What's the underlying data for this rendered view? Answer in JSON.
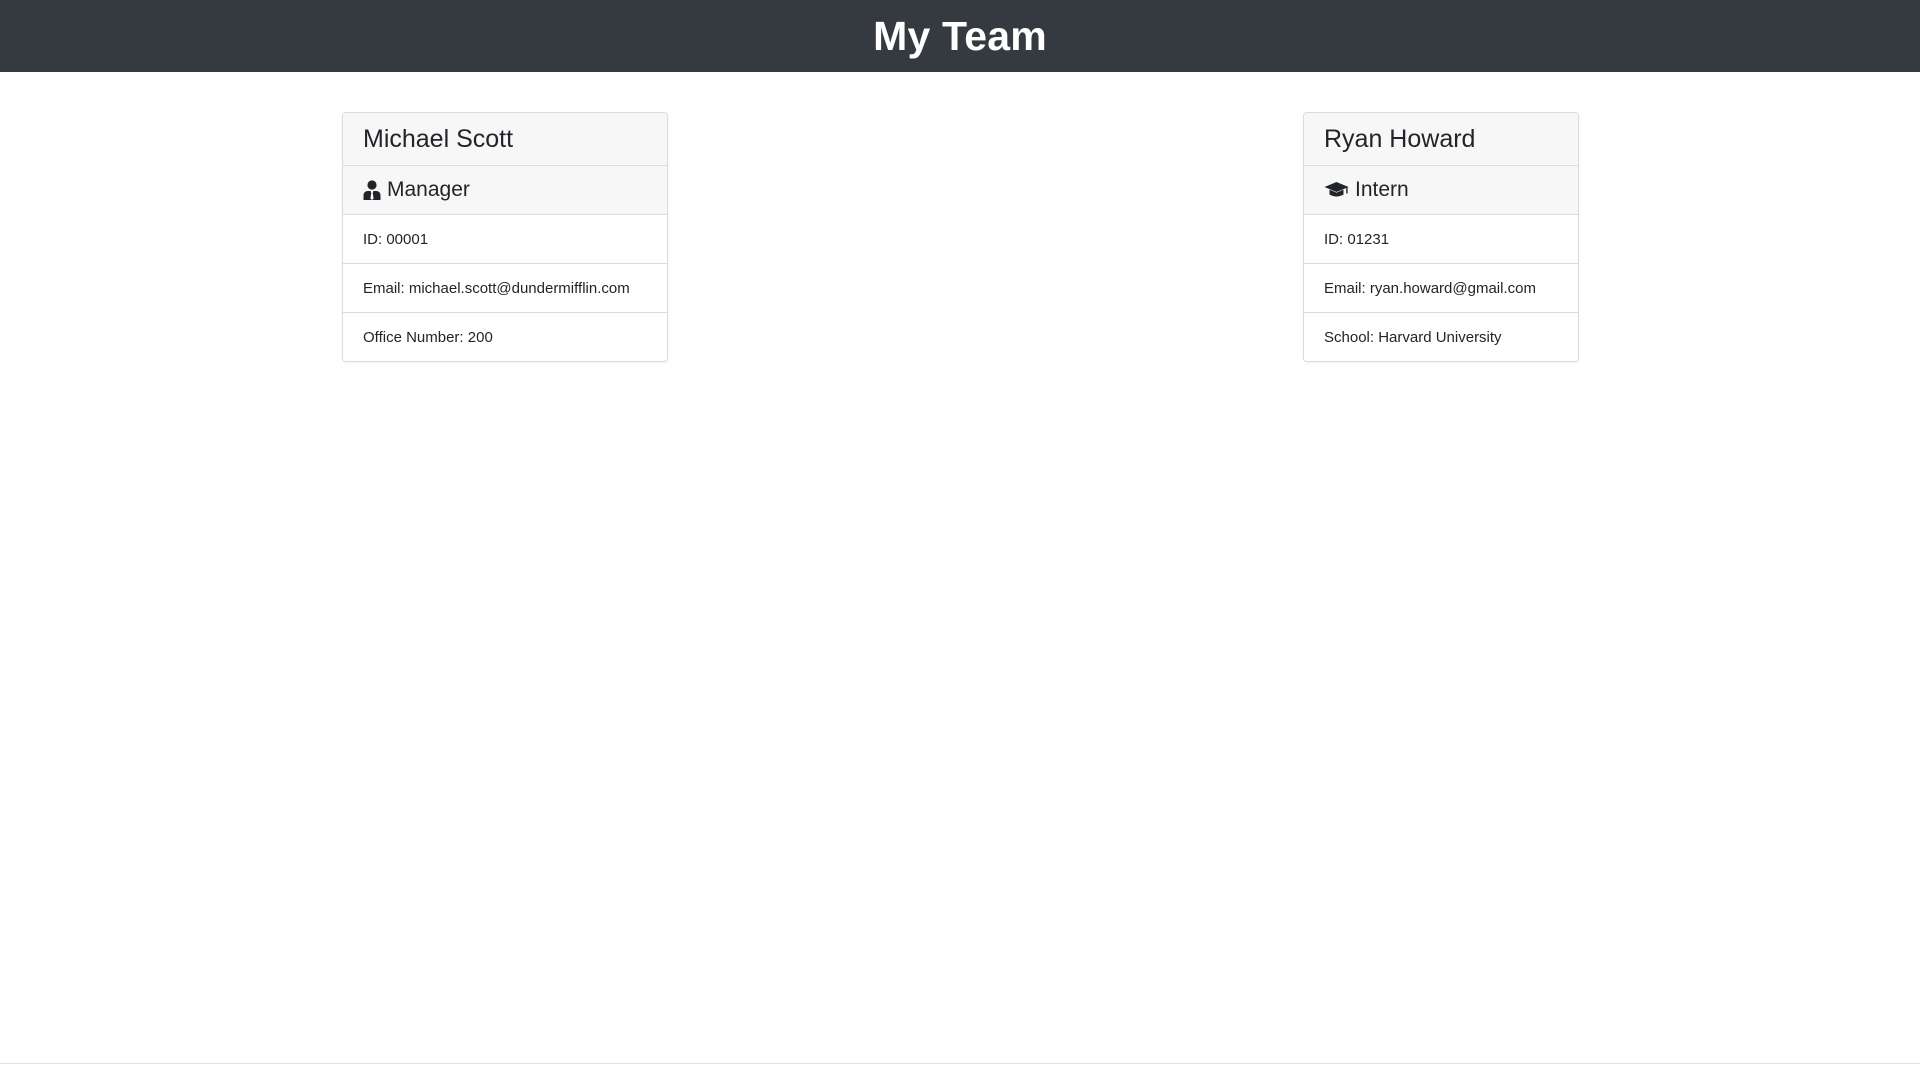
{
  "header": {
    "title": "My Team"
  },
  "team": [
    {
      "name": "Michael Scott",
      "role": "Manager",
      "role_icon": "user-tie-icon",
      "details": [
        "ID: 00001",
        "Email: michael.scott@dundermifflin.com",
        "Office Number: 200"
      ]
    },
    {
      "name": "Ryan Howard",
      "role": "Intern",
      "role_icon": "graduation-cap-icon",
      "details": [
        "ID: 01231",
        "Email: ryan.howard@gmail.com",
        "School: Harvard University"
      ]
    }
  ]
}
